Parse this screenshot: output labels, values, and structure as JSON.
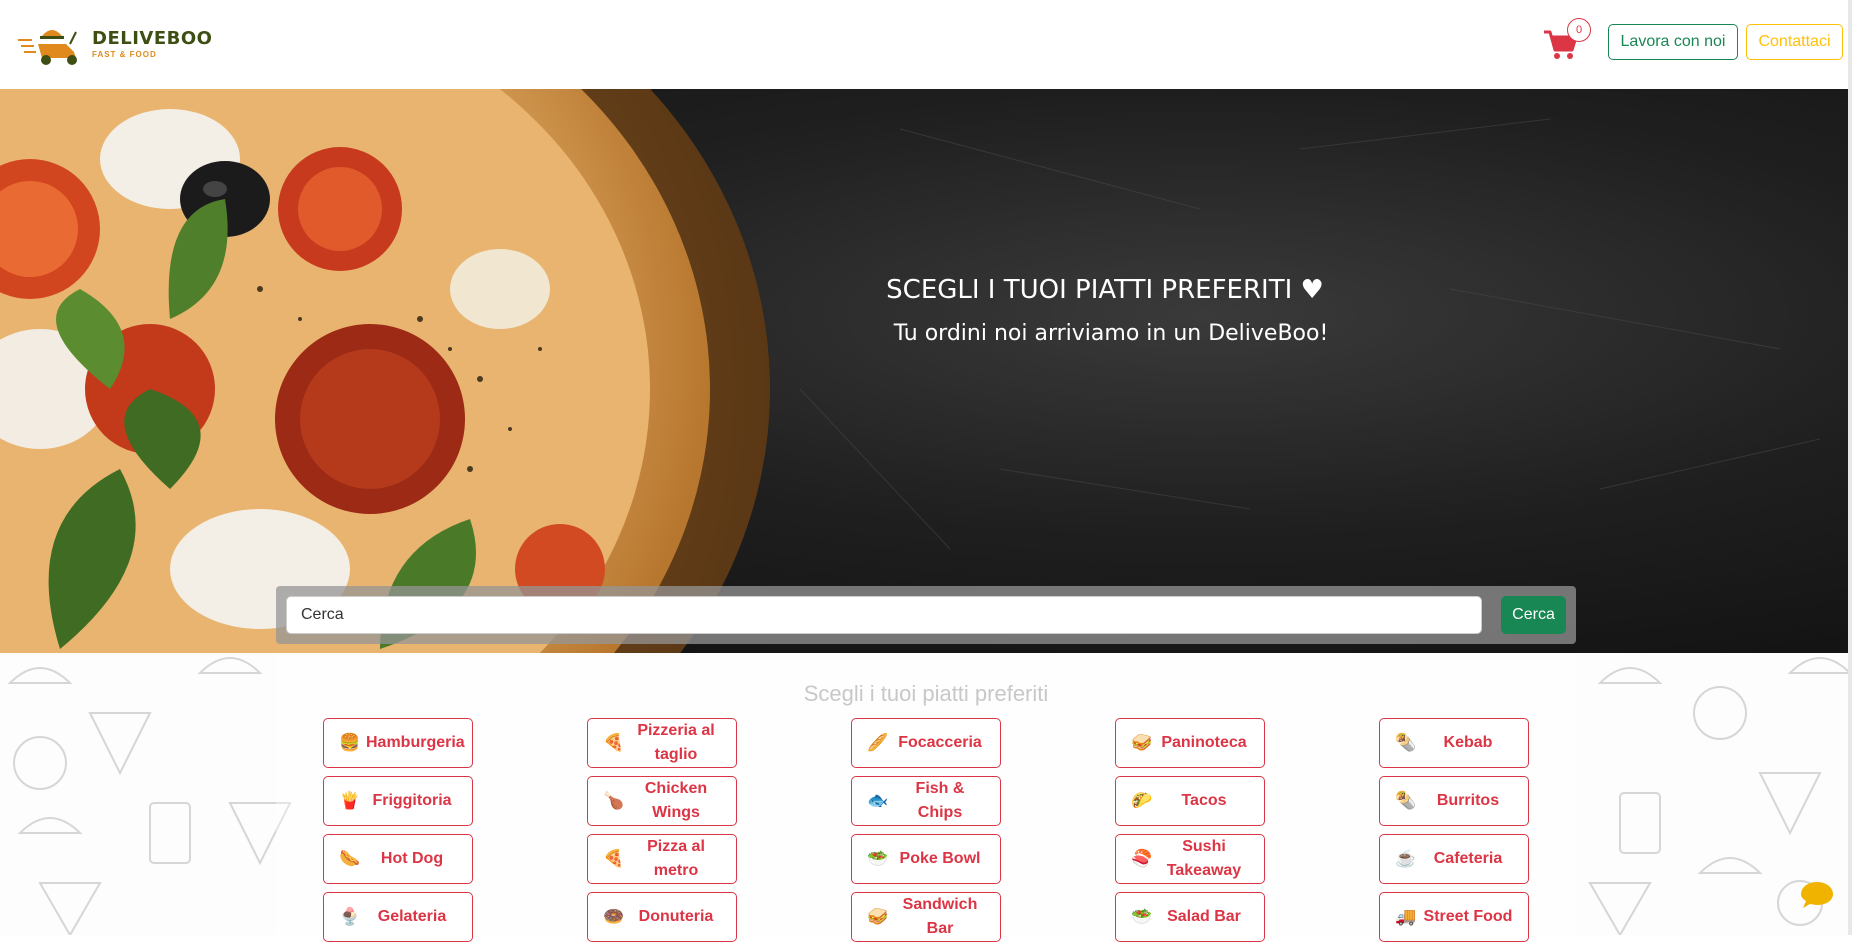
{
  "brand": {
    "name": "DELIVEBOO",
    "tagline": "FAST & FOOD"
  },
  "nav": {
    "cart_count": "0",
    "work_label": "Lavora con noi",
    "contact_label": "Contattaci"
  },
  "hero": {
    "title": "SCEGLI I TUOI PIATTI PREFERITI ♥",
    "subtitle": "Tu ordini noi arriviamo in un DeliveBoo!"
  },
  "search": {
    "placeholder": "Cerca",
    "button_label": "Cerca"
  },
  "categories": {
    "heading": "Scegli i tuoi piatti preferiti",
    "items": [
      {
        "label": "Hamburgeria",
        "icon": "burger-icon"
      },
      {
        "label": "Pizzeria al taglio",
        "icon": "pizza-icon"
      },
      {
        "label": "Focacceria",
        "icon": "focaccia-icon"
      },
      {
        "label": "Paninoteca",
        "icon": "sandwich-icon"
      },
      {
        "label": "Kebab",
        "icon": "kebab-icon"
      },
      {
        "label": "Friggitoria",
        "icon": "fryer-icon"
      },
      {
        "label": "Chicken Wings",
        "icon": "chicken-wings-icon"
      },
      {
        "label": "Fish & Chips",
        "icon": "fish-chips-icon"
      },
      {
        "label": "Tacos",
        "icon": "taco-icon"
      },
      {
        "label": "Burritos",
        "icon": "burrito-icon"
      },
      {
        "label": "Hot Dog",
        "icon": "hotdog-icon"
      },
      {
        "label": "Pizza al metro",
        "icon": "pizza-slice-icon"
      },
      {
        "label": "Poke Bowl",
        "icon": "poke-bowl-icon"
      },
      {
        "label": "Sushi Takeaway",
        "icon": "sushi-icon"
      },
      {
        "label": "Cafeteria",
        "icon": "coffee-icon"
      },
      {
        "label": "Gelateria",
        "icon": "ice-cream-icon"
      },
      {
        "label": "Donuteria",
        "icon": "donut-icon"
      },
      {
        "label": "Sandwich Bar",
        "icon": "sandwich-bar-icon"
      },
      {
        "label": "Salad Bar",
        "icon": "salad-icon"
      },
      {
        "label": "Street Food",
        "icon": "food-truck-icon"
      }
    ]
  },
  "colors": {
    "primary_green": "#198754",
    "danger_red": "#dc3545",
    "warning_yellow": "#ffc107",
    "brand_olive": "#3e4f14",
    "brand_orange": "#e08a1e"
  }
}
